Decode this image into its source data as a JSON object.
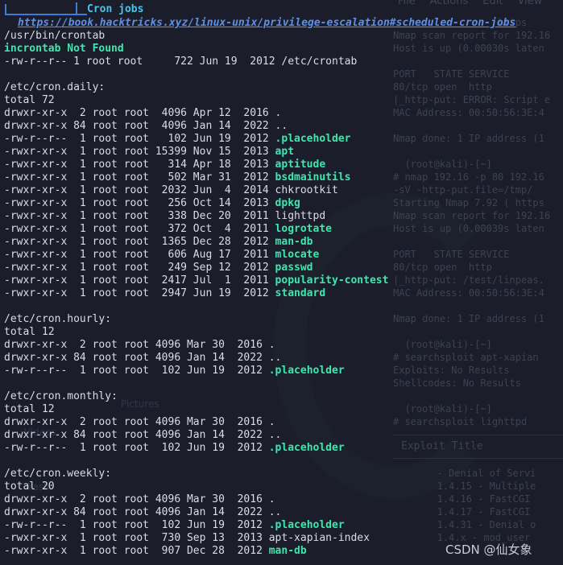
{
  "header": {
    "title": "Cron jobs",
    "url": "https://book.hacktricks.xyz/linux-unix/privilege-escalation#scheduled-cron-jobs"
  },
  "lines": [
    {
      "text": "/usr/bin/crontab"
    },
    {
      "text": "incrontab Not Found",
      "style": "green"
    },
    {
      "text": "-rw-r--r-- 1 root root     722 Jun 19  2012 /etc/crontab"
    },
    {
      "text": ""
    },
    {
      "text": "/etc/cron.daily:"
    },
    {
      "text": "total 72"
    },
    {
      "text": "drwxr-xr-x  2 root root  4096 Apr 12  2016 ",
      "name": "."
    },
    {
      "text": "drwxr-xr-x 84 root root  4096 Jan 14  2022 ",
      "name": ".."
    },
    {
      "text": "-rw-r--r--  1 root root   102 Jun 19  2012 ",
      "name": ".placeholder",
      "style": "green"
    },
    {
      "text": "-rwxr-xr-x  1 root root 15399 Nov 15  2013 ",
      "name": "apt",
      "style": "green"
    },
    {
      "text": "-rwxr-xr-x  1 root root   314 Apr 18  2013 ",
      "name": "aptitude",
      "style": "green"
    },
    {
      "text": "-rwxr-xr-x  1 root root   502 Mar 31  2012 ",
      "name": "bsdmainutils",
      "style": "green"
    },
    {
      "text": "-rwxr-xr-x  1 root root  2032 Jun  4  2014 ",
      "name": "chkrootkit"
    },
    {
      "text": "-rwxr-xr-x  1 root root   256 Oct 14  2013 ",
      "name": "dpkg",
      "style": "green"
    },
    {
      "text": "-rwxr-xr-x  1 root root   338 Dec 20  2011 ",
      "name": "lighttpd"
    },
    {
      "text": "-rwxr-xr-x  1 root root   372 Oct  4  2011 ",
      "name": "logrotate",
      "style": "green"
    },
    {
      "text": "-rwxr-xr-x  1 root root  1365 Dec 28  2012 ",
      "name": "man-db",
      "style": "green"
    },
    {
      "text": "-rwxr-xr-x  1 root root   606 Aug 17  2011 ",
      "name": "mlocate",
      "style": "green"
    },
    {
      "text": "-rwxr-xr-x  1 root root   249 Sep 12  2012 ",
      "name": "passwd",
      "style": "green"
    },
    {
      "text": "-rwxr-xr-x  1 root root  2417 Jul  1  2011 ",
      "name": "popularity-contest",
      "style": "green"
    },
    {
      "text": "-rwxr-xr-x  1 root root  2947 Jun 19  2012 ",
      "name": "standard",
      "style": "green"
    },
    {
      "text": ""
    },
    {
      "text": "/etc/cron.hourly:"
    },
    {
      "text": "total 12"
    },
    {
      "text": "drwxr-xr-x  2 root root 4096 Mar 30  2016 ",
      "name": "."
    },
    {
      "text": "drwxr-xr-x 84 root root 4096 Jan 14  2022 ",
      "name": ".."
    },
    {
      "text": "-rw-r--r--  1 root root  102 Jun 19  2012 ",
      "name": ".placeholder",
      "style": "green"
    },
    {
      "text": ""
    },
    {
      "text": "/etc/cron.monthly:"
    },
    {
      "text": "total 12"
    },
    {
      "text": "drwxr-xr-x  2 root root 4096 Mar 30  2016 ",
      "name": "."
    },
    {
      "text": "drwxr-xr-x 84 root root 4096 Jan 14  2022 ",
      "name": ".."
    },
    {
      "text": "-rw-r--r--  1 root root  102 Jun 19  2012 ",
      "name": ".placeholder",
      "style": "green"
    },
    {
      "text": ""
    },
    {
      "text": "/etc/cron.weekly:"
    },
    {
      "text": "total 20"
    },
    {
      "text": "drwxr-xr-x  2 root root 4096 Mar 30  2016 ",
      "name": "."
    },
    {
      "text": "drwxr-xr-x 84 root root 4096 Jan 14  2022 ",
      "name": ".."
    },
    {
      "text": "-rw-r--r--  1 root root  102 Jun 19  2012 ",
      "name": ".placeholder",
      "style": "green"
    },
    {
      "text": "-rwxr-xr-x  1 root root  730 Sep 13  2013 ",
      "name": "apt-xapian-index"
    },
    {
      "text": "-rwxr-xr-x  1 root root  907 Dec 28  2012 ",
      "name": "man-db",
      "style": "green"
    }
  ],
  "background": {
    "menu": [
      "File",
      "Actions",
      "Edit",
      "View"
    ],
    "lines": [
      "                  https",
      "Nmap scan report for 192.16",
      "Host is up (0.00030s laten",
      "",
      "PORT   STATE SERVICE",
      "80/tcp open  http",
      "|_http-put: ERROR: Script e",
      "MAC Address: 00:50:56:3E:4",
      "",
      "Nmap done: 1 IP address (1",
      "",
      "  (root@kali)-[~]",
      "# nmap 192.16 -p 80 192.16",
      "-sV -http-put.file=/tmp/",
      "Starting Nmap 7.92 ( https",
      "Nmap scan report for 192.16",
      "Host is up (0.00039s laten",
      "",
      "PORT   STATE SERVICE",
      "80/tcp open  http",
      "|_http-put: /test/linpeas.",
      "MAC Address: 00:50:56:3E:4",
      "",
      "Nmap done: 1 IP address (1",
      "",
      "  (root@kali)-[~]",
      "# searchsploit apt-xapian",
      "Exploits: No Results",
      "Shellcodes: No Results",
      "",
      "  (root@kali)-[~]",
      "# searchsploit lighttpd"
    ],
    "exploit_title": "Exploit Title",
    "exploit_rows": [
      "       - Denial of Servi",
      "       1.4.15 - Multiple",
      "       1.4.16 - FastCGI",
      "       1.4.17 - FastCGI",
      "       1.4.31 - Denial o",
      "       1.4.x - mod_user"
    ],
    "desktop_labels": [
      "Pictures",
      "Videos",
      "Trash"
    ]
  },
  "watermark": "CSDN @仙女象",
  "colors": {
    "background": "#1b1e2a",
    "text": "#d8dde6",
    "highlight": "#3ee6b0",
    "title": "#4ac5e8",
    "url": "#5f8fe6",
    "frame": "#3d7bd9"
  }
}
